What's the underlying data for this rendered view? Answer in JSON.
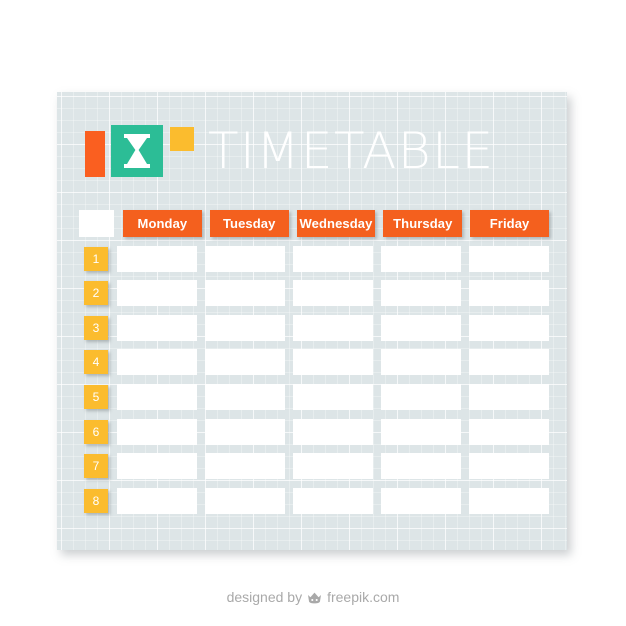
{
  "page": {
    "background_color": "#ffffff"
  },
  "card": {
    "background_color": "#dde5e7"
  },
  "header": {
    "title": "TIMETABLE",
    "logo": {
      "bar_color": "#fa5f20",
      "square_color": "#2cbd96",
      "mini_square_color": "#fbbc2e",
      "icon": "hourglass-icon"
    }
  },
  "table": {
    "accent_color": "#f4601e",
    "badge_color": "#fbbc2e",
    "cell_color": "#ffffff",
    "corner_label": "",
    "days": [
      "Monday",
      "Tuesday",
      "Wednesday",
      "Thursday",
      "Friday"
    ],
    "periods": [
      "1",
      "2",
      "3",
      "4",
      "5",
      "6",
      "7",
      "8"
    ],
    "cells": [
      [
        "",
        "",
        "",
        "",
        ""
      ],
      [
        "",
        "",
        "",
        "",
        ""
      ],
      [
        "",
        "",
        "",
        "",
        ""
      ],
      [
        "",
        "",
        "",
        "",
        ""
      ],
      [
        "",
        "",
        "",
        "",
        ""
      ],
      [
        "",
        "",
        "",
        "",
        ""
      ],
      [
        "",
        "",
        "",
        "",
        ""
      ],
      [
        "",
        "",
        "",
        "",
        ""
      ]
    ]
  },
  "footer": {
    "prefix": "designed by",
    "brand": "freepik.com",
    "icon": "freepik-crown-icon"
  }
}
